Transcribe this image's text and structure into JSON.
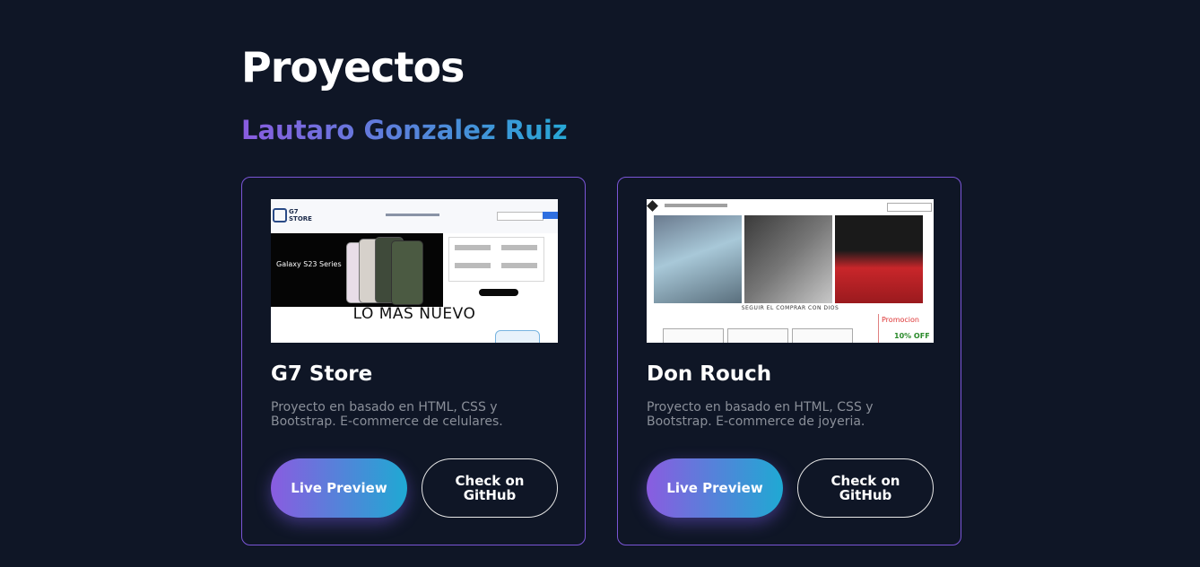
{
  "page": {
    "title": "Proyectos",
    "subtitle": "Lautaro Gonzalez Ruiz"
  },
  "colors": {
    "background": "#0f1626",
    "accent_start": "#8a5ce0",
    "accent_end": "#27a8d6",
    "card_border": "#7a55d6",
    "muted_text": "#8a8f99"
  },
  "projects": [
    {
      "name": "G7 Store",
      "description": "Proyecto en basado en HTML, CSS y Bootstrap. E-commerce de celulares.",
      "live_label": "Live Preview",
      "github_label": "Check on GitHub",
      "thumbnail": {
        "brand_top": "G7",
        "brand_bottom": "STORE",
        "banner_text": "Galaxy S23 Series",
        "headline": "LO MAS NUEVO"
      }
    },
    {
      "name": "Don Rouch",
      "description": "Proyecto en basado en HTML, CSS y Bootstrap. E-commerce de joyeria.",
      "live_label": "Live Preview",
      "github_label": "Check on GitHub",
      "thumbnail": {
        "caption": "SEGUIR EL COMPRAR CON DIOS",
        "promo": "Promocion",
        "discount": "10% OFF"
      }
    }
  ]
}
